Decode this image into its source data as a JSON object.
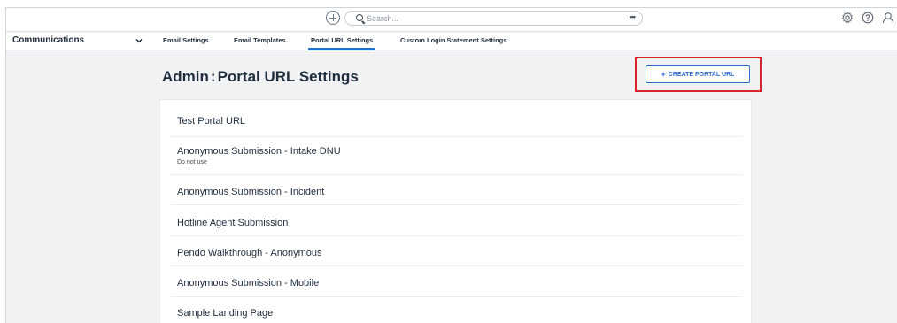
{
  "topbar": {
    "search_placeholder": "Search...",
    "more": "•••",
    "icons": [
      "add-icon",
      "search-icon",
      "more-icon",
      "gear-icon",
      "help-icon",
      "user-icon"
    ]
  },
  "nav": {
    "module": "Communications",
    "tabs": [
      {
        "label": "Email Settings",
        "active": false
      },
      {
        "label": "Email Templates",
        "active": false
      },
      {
        "label": "Portal URL Settings",
        "active": true
      },
      {
        "label": "Custom Login Statement Settings",
        "active": false
      }
    ]
  },
  "page": {
    "title_prefix": "Admin",
    "title_sep": ":",
    "title_main": "Portal URL Settings",
    "create_button": "CREATE PORTAL URL",
    "create_button_plus": "+"
  },
  "items": [
    {
      "title": "Test Portal URL",
      "subtitle": ""
    },
    {
      "title": "Anonymous Submission - Intake DNU",
      "subtitle": "Do not use"
    },
    {
      "title": "Anonymous Submission - Incident",
      "subtitle": ""
    },
    {
      "title": "Hotline Agent Submission",
      "subtitle": ""
    },
    {
      "title": "Pendo Walkthrough - Anonymous",
      "subtitle": ""
    },
    {
      "title": "Anonymous Submission - Mobile",
      "subtitle": ""
    },
    {
      "title": "Sample Landing Page",
      "subtitle": ""
    }
  ],
  "colors": {
    "accent": "#2f6fcf",
    "highlight": "#d8242d",
    "background": "#f0f2f4"
  }
}
